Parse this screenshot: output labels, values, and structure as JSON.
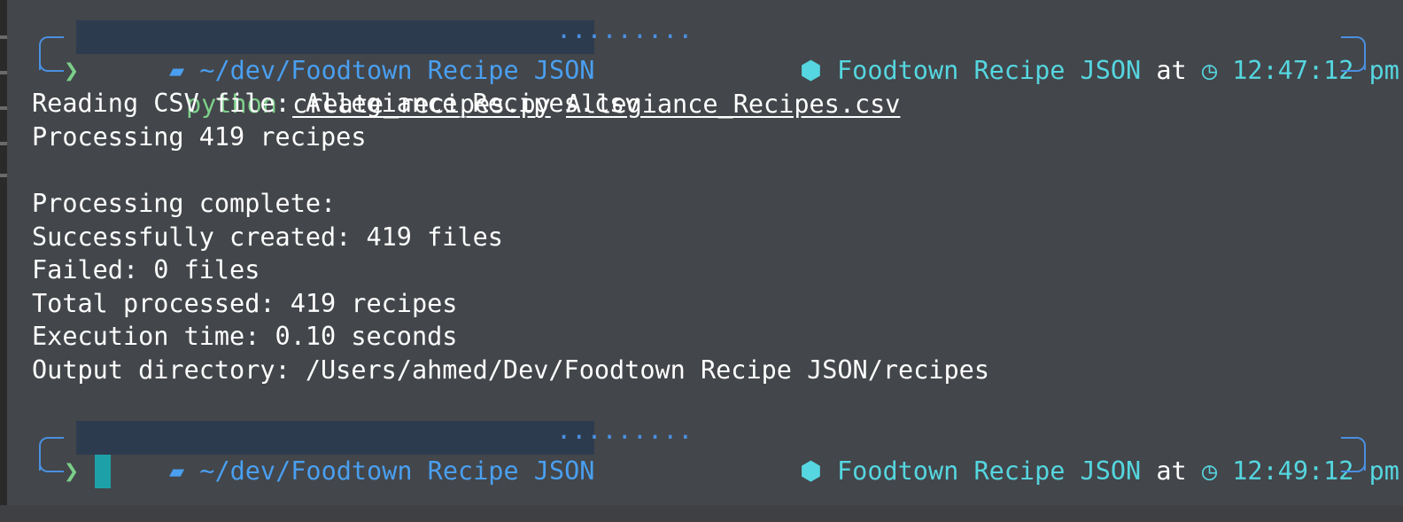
{
  "prompts": [
    {
      "os_icon": "apple-icon",
      "folder_icon": "folder-icon",
      "path": "~/dev/Foodtown Recipe JSON",
      "dots": "·········",
      "project_icon": "node-icon",
      "project_name": "Foodtown Recipe JSON",
      "at_label": "at",
      "clock_icon": "clock-icon",
      "time": "12:47:12 pm",
      "chevron": "❯",
      "command": {
        "program": "python",
        "script": "create_recipes.py",
        "argument": "Allegiance_Recipes.csv"
      }
    },
    {
      "os_icon": "apple-icon",
      "folder_icon": "folder-icon",
      "path": "~/dev/Foodtown Recipe JSON",
      "dots": "·········",
      "project_icon": "node-icon",
      "project_name": "Foodtown Recipe JSON",
      "at_label": "at",
      "clock_icon": "clock-icon",
      "time": "12:49:12 pm",
      "chevron": "❯"
    }
  ],
  "output_lines": [
    "Reading CSV file: Allegiance_Recipes.csv",
    "Processing 419 recipes",
    "",
    "Processing complete:",
    "Successfully created: 419 files",
    "Failed: 0 files",
    "Total processed: 419 recipes",
    "Execution time: 0.10 seconds",
    "Output directory: /Users/ahmed/Dev/Foodtown Recipe JSON/recipes"
  ],
  "colors": {
    "background": "#43464a",
    "path_blue": "#4a9ff0",
    "teal": "#55d6e0",
    "prompt_green": "#7ccf8a",
    "cursor": "#1ea0a8"
  }
}
